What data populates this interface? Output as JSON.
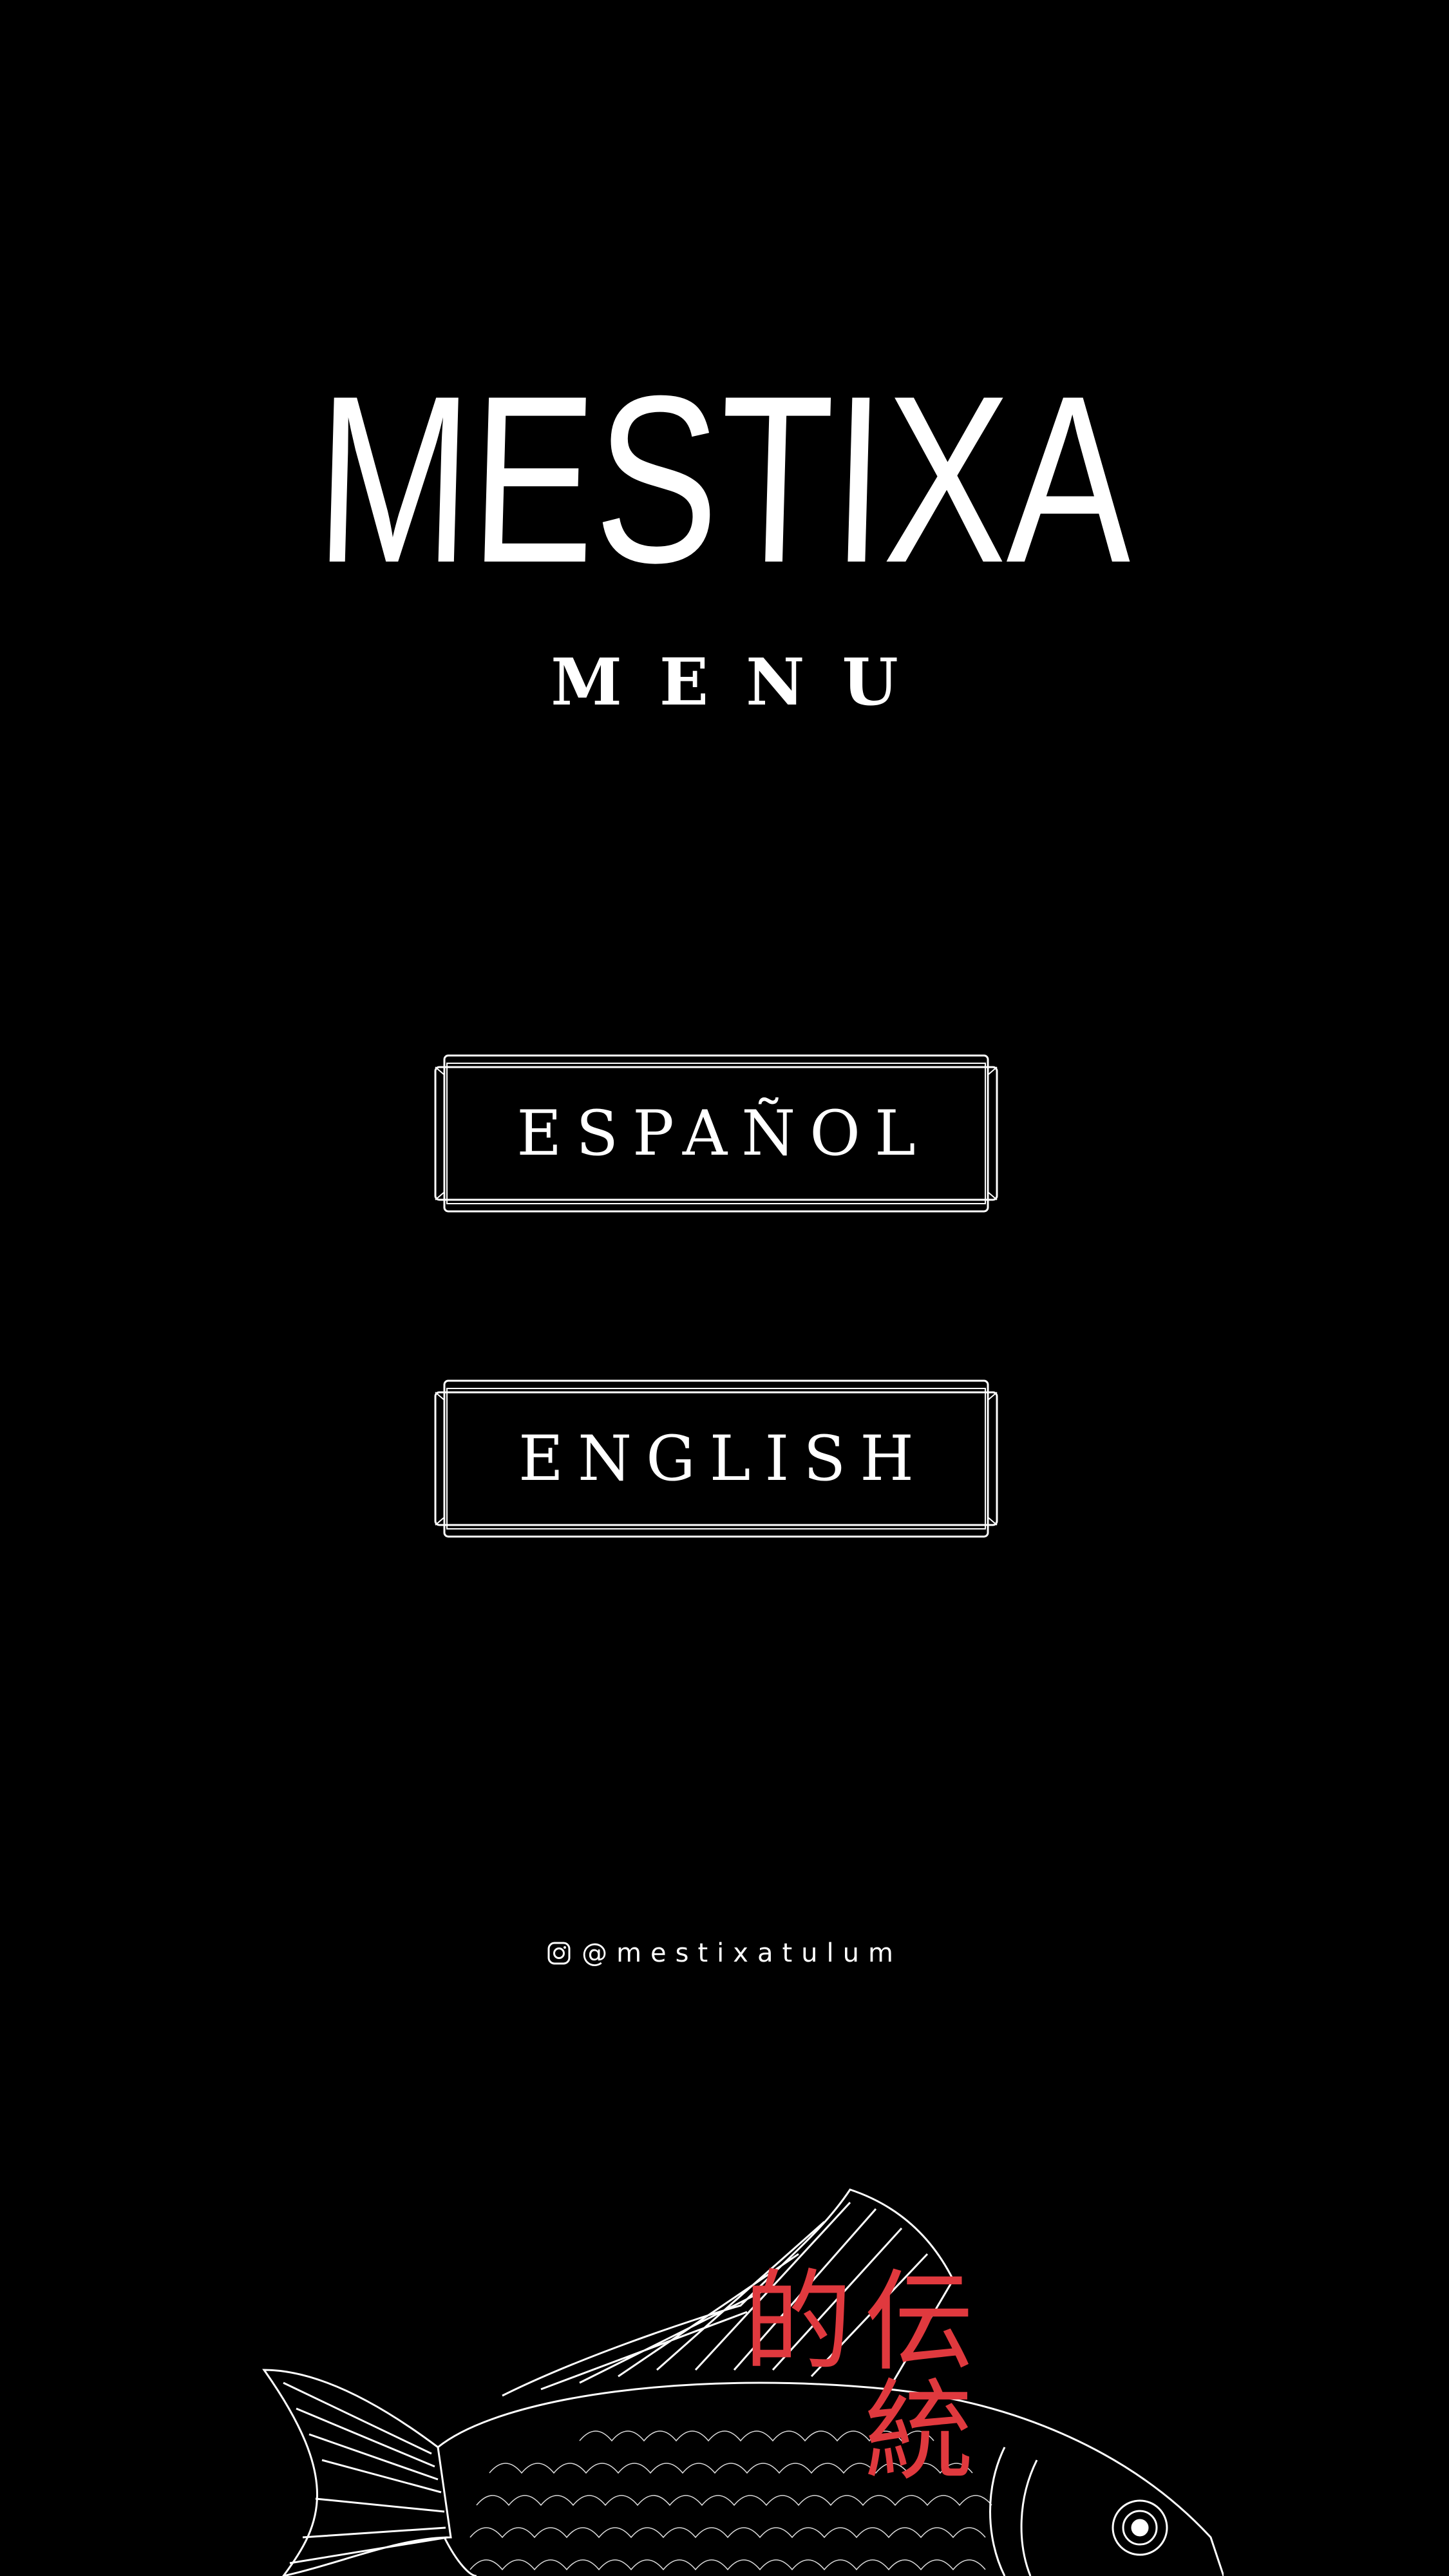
{
  "brand": {
    "logo_text": "MESTIXA",
    "subtitle": "MENU"
  },
  "languages": {
    "spanish_label": "ESPAÑOL",
    "english_label": "ENGLISH"
  },
  "social": {
    "icon": "instagram-icon",
    "handle": "@mestixatulum"
  },
  "decoration": {
    "kanji": "伝統的",
    "kanji_color": "#e0393e",
    "illustration": "carp-fish"
  },
  "colors": {
    "background": "#000000",
    "text": "#ffffff",
    "accent": "#e0393e"
  }
}
